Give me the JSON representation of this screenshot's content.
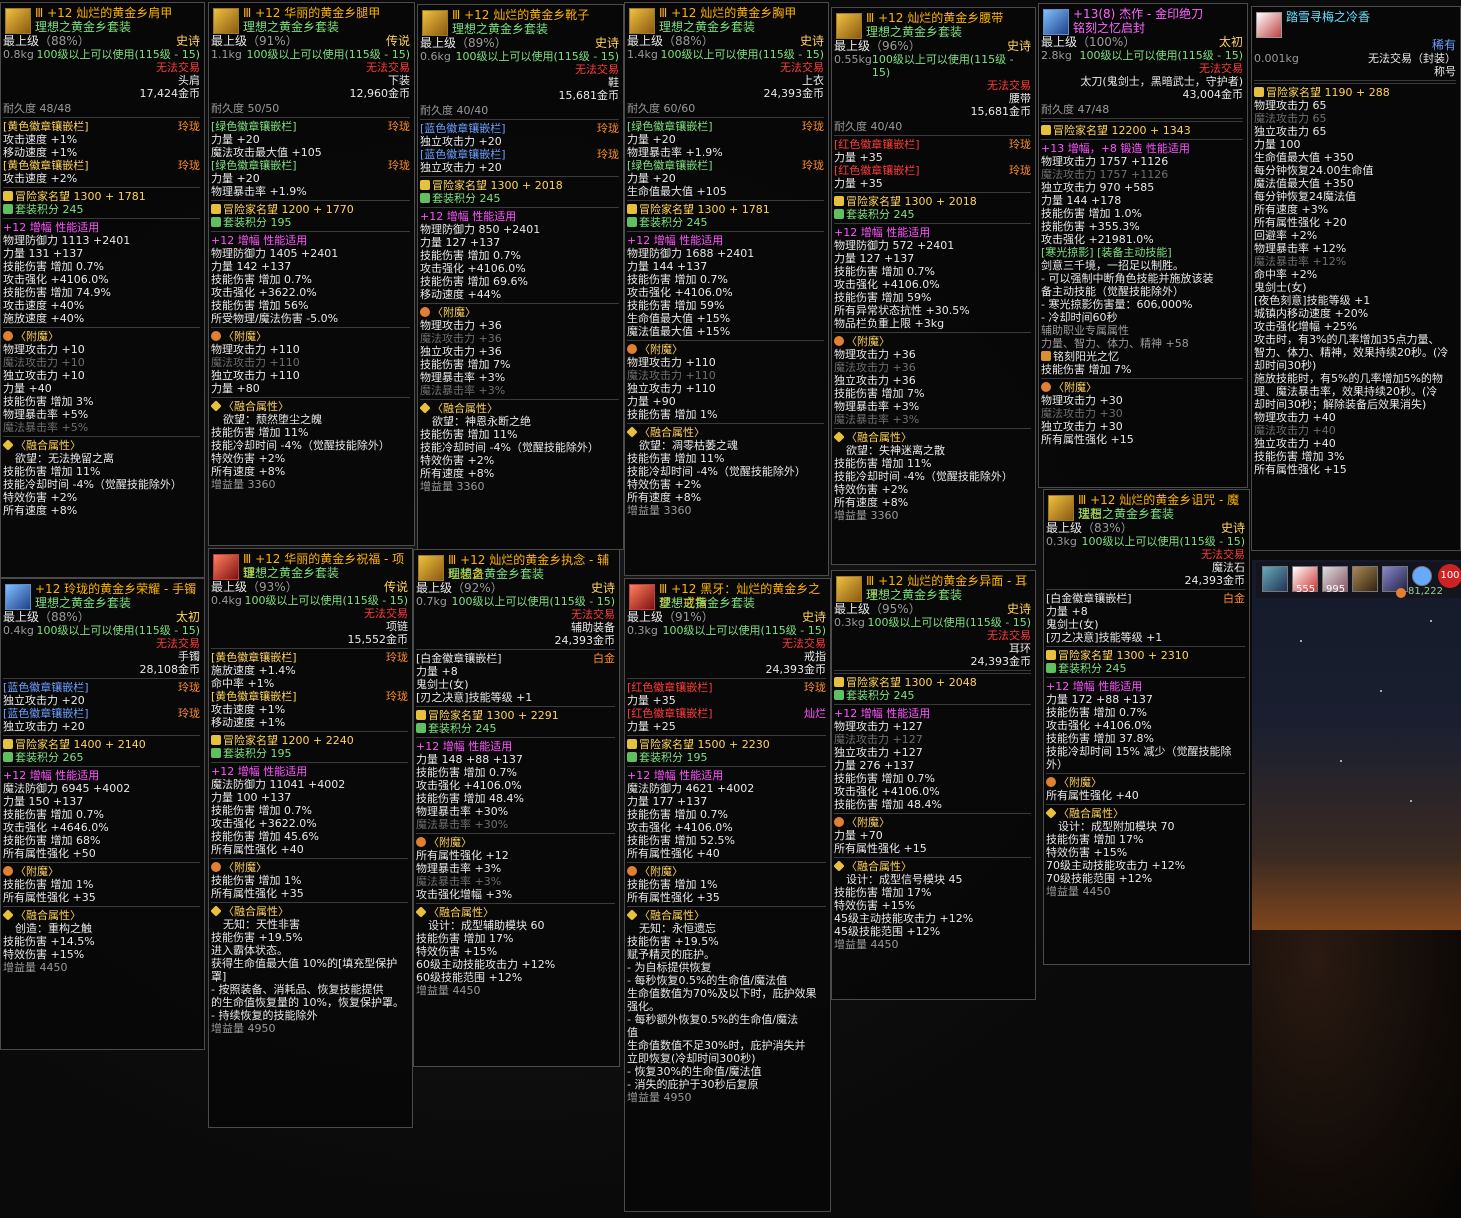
{
  "t1": {
    "name": "Ⅲ +12 灿烂的黄金乡肩甲",
    "set": "理想之黄金乡套装",
    "grade": "最上级",
    "pct": "（88%）",
    "rarity": "史诗",
    "wt": "0.8kg",
    "lvl": "100级以上可以使用(115级 - 15)",
    "trade": "无法交易",
    "slot": "头肩",
    "price": "17,424金币",
    "dur": "耐久度 48/48",
    "l": [
      "[黄色徽章镶嵌栏]",
      "玲珑",
      "攻击速度 +1%",
      "移动速度 +1%",
      "[黄色徽章镶嵌栏]",
      "玲珑",
      "攻击速度 +2%",
      "冒险家名望 1300 + 1781",
      "套装积分 245",
      "+12  增幅  性能适用",
      "物理防御力 1113  +2401",
      "力量 131  +137",
      "技能伤害  增加 0.7%",
      "攻击强化 +4106.0%",
      "技能伤害  增加 74.9%",
      "攻击速度 +40%",
      "施放速度 +40%",
      "〈附魔〉",
      "物理攻击力 +10",
      "魔法攻击力 +10",
      "独立攻击力 +10",
      "力量 +40",
      "技能伤害  增加 3%",
      "物理暴击率 +5%",
      "魔法暴击率 +5%",
      "〈融合属性〉",
      "欲望：无法挽留之离",
      "技能伤害  增加 11%",
      "技能冷却时间 -4%（觉醒技能除外）",
      "特效伤害 +2%",
      "所有速度 +8%"
    ]
  },
  "t2": {
    "name": "Ⅲ +12 华丽的黄金乡腿甲",
    "set": "理想之黄金乡套装",
    "grade": "最上级",
    "pct": "（91%）",
    "rarity": "传说",
    "wt": "1.1kg",
    "lvl": "100级以上可以使用(115级 - 15)",
    "trade": "无法交易",
    "slot": "下装",
    "price": "12,960金币",
    "dur": "耐久度 50/50",
    "l": [
      "[绿色徽章镶嵌栏]",
      "玲珑",
      "力量 +20",
      "魔法攻击最大值 +105",
      "[绿色徽章镶嵌栏]",
      "玲珑",
      "力量 +20",
      "物理暴击率 +1.9%",
      "冒险家名望 1200 + 1770",
      "套装积分 195",
      "+12  增幅  性能适用",
      "物理防御力 1405  +2401",
      "力量 142  +137",
      "技能伤害  增加 0.7%",
      "攻击强化 +3622.0%",
      "技能伤害  增加 56%",
      "所受物理/魔法伤害 -5.0%",
      "〈附魔〉",
      "物理攻击力 +110",
      "魔法攻击力 +110",
      "独立攻击力 +110",
      "力量 +80",
      "〈融合属性〉",
      "欲望：颓然堕尘之魄",
      "技能伤害  增加 11%",
      "技能冷却时间 -4%（觉醒技能除外）",
      "特效伤害 +2%",
      "所有速度 +8%",
      "增益量 3360"
    ]
  },
  "t3": {
    "name": "Ⅲ +12 灿烂的黄金乡靴子",
    "set": "理想之黄金乡套装",
    "grade": "最上级",
    "pct": "（89%）",
    "rarity": "史诗",
    "wt": "0.6kg",
    "lvl": "100级以上可以使用(115级 - 15)",
    "trade": "无法交易",
    "slot": "鞋",
    "price": "15,681金币",
    "dur": "耐久度 40/40",
    "l": [
      "[蓝色徽章镶嵌栏]",
      "玲珑",
      "独立攻击力 +20",
      "[蓝色徽章镶嵌栏]",
      "玲珑",
      "独立攻击力 +20",
      "冒险家名望 1300 + 2018",
      "套装积分 245",
      "+12  增幅  性能适用",
      "物理防御力 850  +2401",
      "力量 127  +137",
      "技能伤害  增加 0.7%",
      "攻击强化 +4106.0%",
      "技能伤害  增加 69.6%",
      "移动速度 +44%",
      "〈附魔〉",
      "物理攻击力 +36",
      "魔法攻击力 +36",
      "独立攻击力 +36",
      "技能伤害  增加 7%",
      "物理暴击率 +3%",
      "魔法暴击率 +3%",
      "〈融合属性〉",
      "欲望：神恩永断之绝",
      "技能伤害  增加 11%",
      "技能冷却时间 -4%（觉醒技能除外）",
      "特效伤害 +2%",
      "所有速度 +8%",
      "增益量 3360"
    ]
  },
  "t4": {
    "name": "Ⅲ +12 灿烂的黄金乡胸甲",
    "set": "理想之黄金乡套装",
    "grade": "最上级",
    "pct": "（88%）",
    "rarity": "史诗",
    "wt": "1.4kg",
    "lvl": "100级以上可以使用(115级 - 15)",
    "trade": "无法交易",
    "slot": "上衣",
    "price": "24,393金币",
    "dur": "耐久度 60/60",
    "l": [
      "[绿色徽章镶嵌栏]",
      "玲珑",
      "力量 +20",
      "物理暴击率 +1.9%",
      "[绿色徽章镶嵌栏]",
      "玲珑",
      "力量 +20",
      "生命值最大值 +105",
      "冒险家名望 1300 + 1781",
      "套装积分 245",
      "+12  增幅  性能适用",
      "物理防御力 1688  +2401",
      "力量 144  +137",
      "技能伤害  增加 0.7%",
      "攻击强化 +4106.0%",
      "技能伤害  增加 59%",
      "生命值最大值 +15%",
      "魔法值最大值 +15%",
      "〈附魔〉",
      "物理攻击力 +110",
      "魔法攻击力 +110",
      "独立攻击力 +110",
      "力量 +90",
      "技能伤害  增加 1%",
      "〈融合属性〉",
      "欲望：凋零枯萎之魂",
      "技能伤害  增加 11%",
      "技能冷却时间 -4%（觉醒技能除外）",
      "特效伤害 +2%",
      "所有速度 +8%",
      "增益量 3360"
    ]
  },
  "t5": {
    "name": "Ⅲ +12 灿烂的黄金乡腰带",
    "set": "理想之黄金乡套装",
    "grade": "最上级",
    "pct": "（96%）",
    "rarity": "史诗",
    "wt": "0.55kg",
    "lvl": "100级以上可以使用(115级 - 15)",
    "trade": "无法交易",
    "slot": "腰带",
    "price": "15,681金币",
    "dur": "耐久度 40/40",
    "l": [
      "[红色徽章镶嵌栏]",
      "玲珑",
      "力量 +35",
      "[红色徽章镶嵌栏]",
      "玲珑",
      "力量 +35",
      "冒险家名望 1300 + 2018",
      "套装积分 245",
      "+12  增幅  性能适用",
      "物理防御力 572  +2401",
      "力量 127  +137",
      "技能伤害  增加 0.7%",
      "攻击强化 +4106.0%",
      "技能伤害  增加 59%",
      "所有异常状态抗性 +30.5%",
      "物品栏负重上限 +3kg",
      "〈附魔〉",
      "物理攻击力 +36",
      "魔法攻击力 +36",
      "独立攻击力 +36",
      "技能伤害  增加 7%",
      "物理暴击率 +3%",
      "魔法暴击率 +3%",
      "〈融合属性〉",
      "欲望：失神迷离之散",
      "技能伤害  增加 11%",
      "技能冷却时间 -4%（觉醒技能除外）",
      "特效伤害 +2%",
      "所有速度 +8%",
      "增益量 3360"
    ]
  },
  "t6": {
    "name": "+13(8) 杰作 - 金印绝刀",
    "set": "铭刻之忆启封",
    "grade": "最上级",
    "pct": "（100%）",
    "rarity": "太初",
    "wt": "2.8kg",
    "lvl": "100级以上可以使用(115级 - 15)",
    "trade": "无法交易",
    "slot": "太刀(鬼剑士，黑暗武士，守护者)",
    "price": "43,004金币",
    "dur": "耐久度 47/48",
    "l": [
      "冒险家名望 12200 + 1343",
      "+13  增幅，+8  锻造  性能适用",
      "物理攻击力 1757  +1126",
      "魔法攻击力 1757  +1126",
      "独立攻击力 970  +585",
      "力量 144  +178",
      "技能伤害  增加 1.0%",
      "技能伤害 +355.3%",
      "攻击强化 +21981.0%",
      "[寒光掠影] [装备主动技能]",
      "剑意三千境，一招足以制胜。",
      "- 可以强制中断角色技能并施放该装",
      "备主动技能（觉醒技能除外）",
      "- 寒光掠影伤害量：606,000%",
      "- 冷却时间60秒",
      "辅助职业专属属性",
      "力量、智力、体力、精神 +58",
      "铭刻阳光之忆",
      "技能伤害  增加 7%",
      "〈附魔〉",
      "物理攻击力 +30",
      "魔法攻击力 +30",
      "独立攻击力 +30",
      "所有属性强化 +15"
    ]
  },
  "t7": {
    "name": "踏雪寻梅之冷香",
    "rarity": "稀有",
    "wt": "0.001kg",
    "trade": "无法交易（封装）",
    "slot": "称号",
    "l": [
      "冒险家名望 1190 + 288",
      "物理攻击力 65",
      "魔法攻击力 65",
      "独立攻击力 65",
      "力量 100",
      "生命值最大值 +350",
      "每分钟恢复24.00生命值",
      "魔法值最大值 +350",
      "每分钟恢复24魔法值",
      "所有速度 +3%",
      "所有属性强化 +20",
      "回避率 +2%",
      "物理暴击率 +12%",
      "魔法暴击率 +12%",
      "命中率 +2%",
      "鬼剑士(女)",
      "[夜色刻意]技能等级 +1",
      "城镇内移动速度 +20%",
      "攻击强化增幅 +25%",
      "攻击时，有3%的几率增加35点力量、",
      "智力、体力、精神，效果持续20秒。(冷",
      "却时间30秒)",
      "施放技能时，有5%的几率增加5%的物",
      "理、魔法暴击率，效果持续20秒。(冷",
      "却时间30秒；解除装备后效果消失)",
      "物理攻击力 +40",
      "魔法攻击力 +40",
      "独立攻击力 +40",
      "技能伤害  增加 3%",
      "所有属性强化 +15"
    ]
  },
  "t8": {
    "name": "+12 玲珑的黄金乡荣耀 - 手镯",
    "set": "理想之黄金乡套装",
    "grade": "最上级",
    "pct": "（88%）",
    "rarity": "太初",
    "wt": "0.4kg",
    "lvl": "100级以上可以使用(115级 - 15)",
    "trade": "无法交易",
    "slot": "手镯",
    "price": "28,108金币",
    "l": [
      "[蓝色徽章镶嵌栏]",
      "玲珑",
      "独立攻击力 +20",
      "[蓝色徽章镶嵌栏]",
      "玲珑",
      "独立攻击力 +20",
      "冒险家名望 1400 + 2140",
      "套装积分 265",
      "+12  增幅  性能适用",
      "魔法防御力 6945  +4002",
      "力量 150  +137",
      "技能伤害  增加 0.7%",
      "攻击强化 +4646.0%",
      "技能伤害  增加 68%",
      "所有属性强化 +50",
      "〈附魔〉",
      "技能伤害  增加 1%",
      "所有属性强化 +35",
      "〈融合属性〉",
      "创造：重构之触",
      "技能伤害 +14.5%",
      "特效伤害 +15%",
      "增益量 4450"
    ]
  },
  "t9": {
    "name": "Ⅲ +12 华丽的黄金乡祝福 - 项链",
    "set": "理想之黄金乡套装",
    "grade": "最上级",
    "pct": "（93%）",
    "rarity": "传说",
    "wt": "0.4kg",
    "lvl": "100级以上可以使用(115级 - 15)",
    "trade": "无法交易",
    "slot": "项链",
    "price": "15,552金币",
    "l": [
      "[黄色徽章镶嵌栏]",
      "玲珑",
      "施放速度 +1.4%",
      "命中率 +1%",
      "[黄色徽章镶嵌栏]",
      "玲珑",
      "攻击速度 +1%",
      "移动速度 +1%",
      "冒险家名望 1200 + 2240",
      "套装积分 195",
      "+12  增幅  性能适用",
      "魔法防御力 11041  +4002",
      "力量 100  +137",
      "技能伤害  增加 0.7%",
      "攻击强化 +3622.0%",
      "技能伤害  增加 45.6%",
      "所有属性强化 +40",
      "〈附魔〉",
      "技能伤害  增加 1%",
      "所有属性强化 +35",
      "〈融合属性〉",
      "无知：天性非害",
      "技能伤害 +19.5%",
      "进入霸体状态。",
      "获得生命值最大值 10%的[填充型保护",
      "罩]",
      "- 按照装备、消耗品、恢复技能提供",
      "的生命值恢复量的 10%，恢复保护罩。",
      "- 持续恢复的技能除外",
      "增益量 4950"
    ]
  },
  "t10": {
    "name": "Ⅲ +12 灿烂的黄金乡执念 - 辅助装备",
    "set": "理想之黄金乡套装",
    "grade": "最上级",
    "pct": "（92%）",
    "rarity": "史诗",
    "wt": "0.7kg",
    "lvl": "100级以上可以使用(115级 - 15)",
    "trade": "无法交易",
    "slot": "辅助装备",
    "price": "24,393金币",
    "l": [
      "[白金徽章镶嵌栏]",
      "白金",
      "力量 +8",
      "鬼剑士(女)",
      "[刃之决意]技能等级 +1",
      "冒险家名望 1300 + 2291",
      "套装积分 245",
      "+12  增幅  性能适用",
      "力量 148  +88  +137",
      "技能伤害  增加 0.7%",
      "攻击强化 +4106.0%",
      "技能伤害  增加 48.4%",
      "物理暴击率 +30%",
      "魔法暴击率 +30%",
      "〈附魔〉",
      "所有属性强化 +12",
      "物理暴击率 +3%",
      "魔法暴击率 +3%",
      "攻击强化增幅 +3%",
      "〈融合属性〉",
      "设计：成型辅助模块 60",
      "技能伤害  增加 17%",
      "特效伤害 +15%",
      "60级主动技能攻击力 +12%",
      "60级技能范围 +12%",
      "增益量 4450"
    ]
  },
  "t11": {
    "name": "Ⅲ +12 黑牙：灿烂的黄金乡之梦 - 戒指",
    "set": "理想之黄金乡套装",
    "grade": "最上级",
    "pct": "（91%）",
    "rarity": "史诗",
    "wt": "0.3kg",
    "lvl": "100级以上可以使用(115级 - 15)",
    "trade": "无法交易",
    "slot": "戒指",
    "price": "24,393金币",
    "l": [
      "[红色徽章镶嵌栏]",
      "玲珑",
      "力量 +35",
      "[红色徽章镶嵌栏]",
      "灿烂",
      "力量 +25",
      "冒险家名望 1500 + 2230",
      "套装积分 195",
      "+12  增幅  性能适用",
      "魔法防御力 4621  +4002",
      "力量 177  +137",
      "技能伤害  增加 0.7%",
      "攻击强化 +4106.0%",
      "技能伤害  增加 52.5%",
      "所有属性强化 +40",
      "〈附魔〉",
      "技能伤害  增加 1%",
      "所有属性强化 +35",
      "〈融合属性〉",
      "无知：永恒遗忘",
      "技能伤害 +19.5%",
      "赋予精灵的庇护。",
      "- 为自标提供恢复",
      "- 每秒恢复0.5%的生命值/魔法值",
      "生命值数值为70%及以下时，庇护效果",
      "强化。",
      "- 每秒额外恢复0.5%的生命值/魔法",
      "值",
      "生命值数值不足30%时，庇护消失并",
      "立即恢复(冷却时间300秒)",
      "- 恢复30%的生命值/魔法值",
      "- 消失的庇护于30秒后复原",
      "增益量 4950"
    ]
  },
  "t12": {
    "name": "Ⅲ +12 灿烂的黄金乡异面 - 耳环",
    "set": "理想之黄金乡套装",
    "grade": "最上级",
    "pct": "（95%）",
    "rarity": "史诗",
    "wt": "0.3kg",
    "lvl": "100级以上可以使用(115级 - 15)",
    "trade": "无法交易",
    "slot": "耳环",
    "price": "24,393金币",
    "l": [
      "冒险家名望 1300 + 2048",
      "套装积分 245",
      "+12  增幅  性能适用",
      "物理攻击力 +127",
      "魔法攻击力 +127",
      "独立攻击力 +127",
      "力量 276  +137",
      "技能伤害  增加 0.7%",
      "攻击强化 +4106.0%",
      "技能伤害  增加 48.4%",
      "〈附魔〉",
      "力量 +70",
      "所有属性强化 +15",
      "〈融合属性〉",
      "设计：成型信号模块 45",
      "技能伤害  增加 17%",
      "特效伤害 +15%",
      "45级主动技能攻击力 +12%",
      "45级技能范围 +12%",
      "增益量 4450"
    ]
  },
  "t13": {
    "name": "Ⅲ +12 灿烂的黄金乡诅咒 - 魔法石",
    "set": "理想之黄金乡套装",
    "grade": "最上级",
    "pct": "（83%）",
    "rarity": "史诗",
    "wt": "0.3kg",
    "lvl": "100级以上可以使用(115级 - 15)",
    "trade": "无法交易",
    "slot": "魔法石",
    "price": "24,393金币",
    "l": [
      "[白金徽章镶嵌栏]",
      "白金",
      "力量 +8",
      "鬼剑士(女)",
      "[刃之决意]技能等级 +1",
      "冒险家名望 1300 + 2310",
      "套装积分 245",
      "+12  增幅  性能适用",
      "力量 172  +88  +137",
      "技能伤害  增加 0.7%",
      "攻击强化 +4106.0%",
      "技能伤害  增加 37.8%",
      "技能冷却时间 15% 减少（觉醒技能除",
      "外）",
      "〈附魔〉",
      "所有属性强化 +40",
      "〈融合属性〉",
      "设计：成型附加模块 70",
      "技能伤害  增加 17%",
      "特效伤害 +15%",
      "70级主动技能攻击力 +12%",
      "70级技能范围 +12%",
      "增益量 4450"
    ]
  },
  "hud": {
    "n1": "555",
    "n2": "995",
    "gold": "81,222",
    "hp": "100"
  }
}
